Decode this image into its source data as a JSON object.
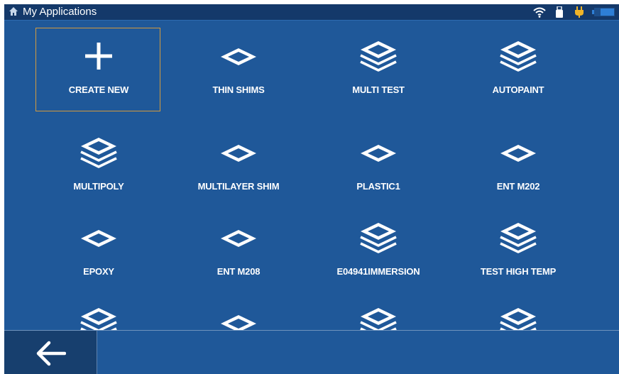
{
  "status_bar": {
    "title": "My Applications",
    "icons": [
      "home-icon",
      "wifi-icon",
      "usb-drive-icon",
      "power-plug-icon",
      "battery-icon"
    ]
  },
  "tiles": [
    {
      "label": "CREATE NEW",
      "icon": "plus-icon",
      "selected": true
    },
    {
      "label": "THIN SHIMS",
      "icon": "single-layer-icon"
    },
    {
      "label": "MULTI TEST",
      "icon": "multi-layer-icon"
    },
    {
      "label": "AUTOPAINT",
      "icon": "multi-layer-icon"
    },
    {
      "label": "MULTIPOLY",
      "icon": "multi-layer-icon"
    },
    {
      "label": "MULTILAYER SHIM",
      "icon": "single-layer-icon"
    },
    {
      "label": "PLASTIC1",
      "icon": "single-layer-icon"
    },
    {
      "label": "ENT M202",
      "icon": "single-layer-icon"
    },
    {
      "label": "EPOXY",
      "icon": "single-layer-icon"
    },
    {
      "label": "ENT M208",
      "icon": "single-layer-icon"
    },
    {
      "label": "E04941IMMERSION",
      "icon": "multi-layer-icon"
    },
    {
      "label": "TEST HIGH TEMP",
      "icon": "multi-layer-icon"
    },
    {
      "label": "",
      "icon": "multi-layer-icon"
    },
    {
      "label": "",
      "icon": "single-layer-icon"
    },
    {
      "label": "",
      "icon": "multi-layer-icon"
    },
    {
      "label": "",
      "icon": "multi-layer-icon"
    }
  ],
  "bottom_bar": {
    "back_icon": "back-arrow-icon"
  },
  "colors": {
    "background": "#1f5899",
    "status_bar": "#14396a",
    "selection_border": "#d29a3e",
    "usb": "#ffffff",
    "power": "#f0b428",
    "battery": "#2e7fd6"
  }
}
